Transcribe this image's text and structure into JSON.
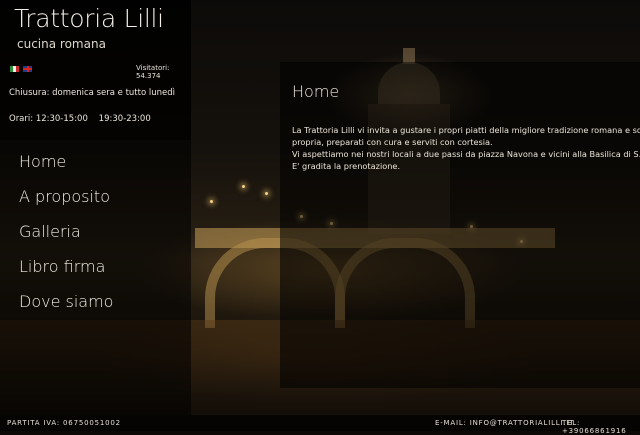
{
  "site": {
    "name": "Trattoria Lilli",
    "tagline": "cucina romana"
  },
  "languages": [
    {
      "code": "it",
      "icon": "italy-flag-icon"
    },
    {
      "code": "en",
      "icon": "uk-flag-icon"
    }
  ],
  "visitors": "Visitatori: 54.374",
  "info": {
    "closure": "Chiusura: domenica sera e tutto lunedì",
    "hours": "Orari: 12:30-15:00    19:30-23:00"
  },
  "nav": [
    {
      "label": "Home"
    },
    {
      "label": "A proposito"
    },
    {
      "label": "Galleria"
    },
    {
      "label": "Libro firma"
    },
    {
      "label": "Dove siamo"
    }
  ],
  "content": {
    "title": "Home",
    "paragraphs": [
      "La Trattoria Lilli vi invita a gustare i propri piatti della migliore tradizione romana e squisiti de",
      "propria, preparati con cura e serviti con cortesia.",
      "Vi aspettiamo nei nostri locali a due passi da piazza Navona e vicini alla Basilica di S.Pietro.",
      "E' gradita la prenotazione."
    ]
  },
  "footer": {
    "vat": "PARTITA IVA: 06750051002",
    "email": "E-MAIL: INFO@TRATTORIALILLI.IT",
    "tel": "TEL: +39066861916"
  },
  "colors": {
    "panel": "#000000",
    "text": "#e8e2d6",
    "footer": "#050403"
  }
}
